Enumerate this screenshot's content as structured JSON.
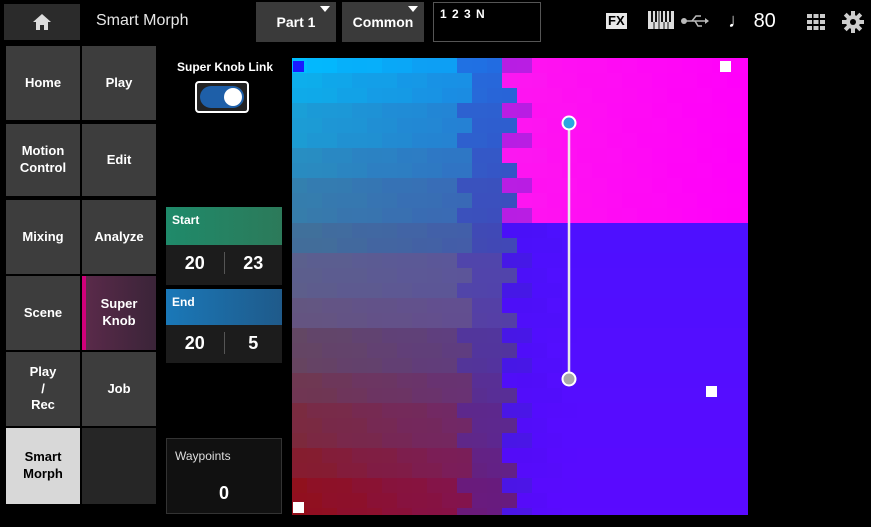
{
  "topbar": {
    "title": "Smart Morph",
    "part_label": "Part 1",
    "common_label": "Common",
    "performance_name": "1 2 3 N",
    "fx_label": "FX",
    "tempo_symbol": "♩",
    "tempo_value": "80"
  },
  "nav": {
    "left": [
      "Home",
      "Motion Control",
      "Mixing",
      "Scene",
      "Play / Rec",
      "Smart Morph"
    ],
    "right": [
      "Play",
      "Edit",
      "Analyze",
      "Super Knob",
      "Job",
      ""
    ]
  },
  "super_knob_link": {
    "label": "Super Knob Link",
    "on": true
  },
  "start": {
    "label": "Start",
    "x": "20",
    "y": "23"
  },
  "end": {
    "label": "End",
    "x": "20",
    "y": "5"
  },
  "waypoints": {
    "label": "Waypoints",
    "value": "0"
  },
  "colors": {
    "accent_start": "#2e8a6a",
    "accent_end": "#2a6cb0",
    "toggle_on": "#1e5fa8",
    "selected_tab": "#d0007a"
  }
}
